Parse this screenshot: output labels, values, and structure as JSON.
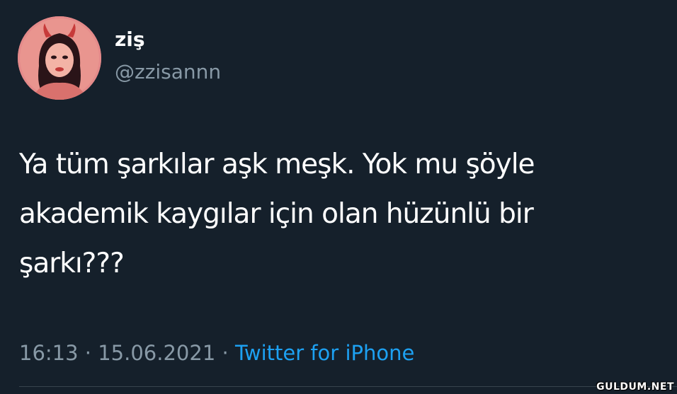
{
  "tweet": {
    "display_name": "ziş",
    "handle": "@zzisannn",
    "text_lines": [
      "Ya tüm şarkılar aşk meşk. Yok mu şöyle",
      "akademik kaygılar için olan hüzünlü bir",
      "şarkı???"
    ],
    "time": "16:13",
    "date": "15.06.2021",
    "separator": "·",
    "source": "Twitter for iPhone"
  },
  "watermark": "GULDUM.NET",
  "colors": {
    "background": "#15202b",
    "text": "#ffffff",
    "secondary": "#8899a6",
    "link": "#1da1f2"
  }
}
